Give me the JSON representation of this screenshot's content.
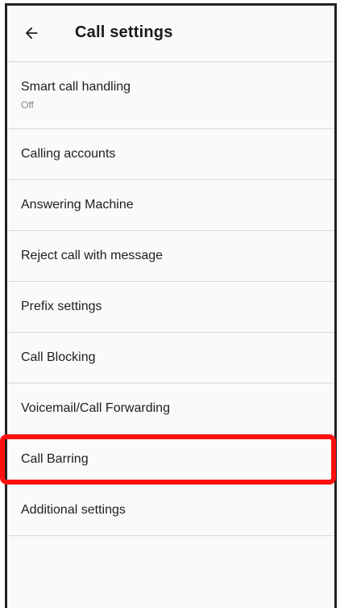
{
  "header": {
    "title": "Call settings",
    "back_icon": "arrow-left-icon"
  },
  "settings": {
    "items": [
      {
        "label": "Smart call handling",
        "sub": "Off"
      },
      {
        "label": "Calling accounts"
      },
      {
        "label": "Answering Machine"
      },
      {
        "label": "Reject call with message"
      },
      {
        "label": "Prefix settings"
      },
      {
        "label": "Call Blocking"
      },
      {
        "label": "Voicemail/Call Forwarding"
      },
      {
        "label": "Call Barring",
        "highlighted": true
      },
      {
        "label": "Additional settings"
      }
    ]
  },
  "colors": {
    "highlight": "#ff1010",
    "background": "#fafafa",
    "divider": "#d9d9d9"
  }
}
